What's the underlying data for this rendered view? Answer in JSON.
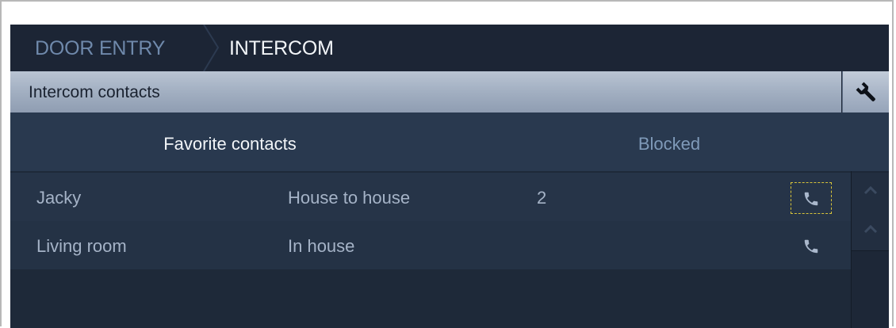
{
  "breadcrumb": {
    "root": "DOOR ENTRY",
    "current": "INTERCOM"
  },
  "section": {
    "title": "Intercom contacts",
    "settings_icon": "wrench-icon"
  },
  "tabs": [
    {
      "label": "Favorite contacts",
      "active": true
    },
    {
      "label": "Blocked",
      "active": false
    }
  ],
  "contacts": [
    {
      "name": "Jacky",
      "type": "House to house",
      "number": "2",
      "action_icon": "phone-icon",
      "focused": true
    },
    {
      "name": "Living room",
      "type": "In house",
      "number": "",
      "action_icon": "phone-icon",
      "focused": false
    }
  ],
  "scroll": {
    "up_icon": "chevron-up-icon"
  },
  "colors": {
    "background": "#1d2737",
    "section_bar": "#a4b1c3",
    "focus_outline": "#d8c43a",
    "accent_text": "#7f9ab9"
  }
}
